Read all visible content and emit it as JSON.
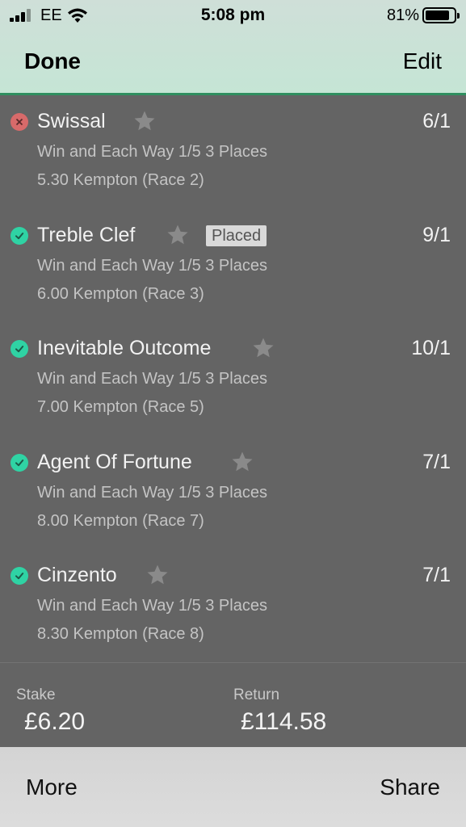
{
  "status_bar": {
    "carrier": "EE",
    "time": "5:08 pm",
    "battery_percent": "81%"
  },
  "nav": {
    "done_label": "Done",
    "edit_label": "Edit"
  },
  "selections": [
    {
      "name": "Swissal",
      "odds": "6/1",
      "market": "Win and Each Way 1/5 3 Places",
      "race": "5.30 Kempton (Race 2)",
      "result": "lost",
      "badge": ""
    },
    {
      "name": "Treble Clef",
      "odds": "9/1",
      "market": "Win and Each Way 1/5 3 Places",
      "race": "6.00 Kempton (Race 3)",
      "result": "won",
      "badge": "Placed"
    },
    {
      "name": "Inevitable Outcome",
      "odds": "10/1",
      "market": "Win and Each Way 1/5 3 Places",
      "race": "7.00 Kempton (Race 5)",
      "result": "won",
      "badge": ""
    },
    {
      "name": "Agent Of Fortune",
      "odds": "7/1",
      "market": "Win and Each Way 1/5 3 Places",
      "race": "8.00 Kempton (Race 7)",
      "result": "won",
      "badge": ""
    },
    {
      "name": "Cinzento",
      "odds": "7/1",
      "market": "Win and Each Way 1/5 3 Places",
      "race": "8.30 Kempton (Race 8)",
      "result": "won",
      "badge": ""
    }
  ],
  "summary": {
    "stake_label": "Stake",
    "stake_value": "£6.20",
    "return_label": "Return",
    "return_value": "£114.58"
  },
  "toolbar": {
    "more_label": "More",
    "share_label": "Share"
  },
  "colors": {
    "won": "#2fd3a4",
    "lost": "#d86a6a",
    "header_accent": "#2f8f5f"
  }
}
